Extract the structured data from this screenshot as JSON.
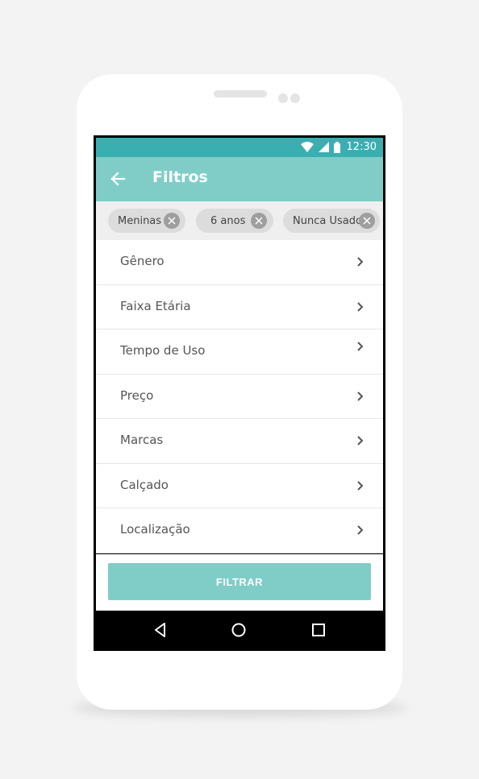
{
  "status_bar": {
    "time": "12:30",
    "icons": [
      "wifi-icon",
      "signal-icon",
      "battery-icon"
    ]
  },
  "app_bar": {
    "title": "Filtros",
    "back_icon": "arrow-left-icon"
  },
  "chips": [
    {
      "label": "Meninas",
      "remove_icon": "close-circle-icon"
    },
    {
      "label": "6 anos",
      "remove_icon": "close-circle-icon"
    },
    {
      "label": "Nunca Usado",
      "remove_icon": "close-circle-icon"
    }
  ],
  "filters": [
    {
      "label": "Gênero"
    },
    {
      "label": "Faixa Etária"
    },
    {
      "label": "Tempo de Uso"
    },
    {
      "label": "Preço"
    },
    {
      "label": "Marcas"
    },
    {
      "label": "Calçado"
    },
    {
      "label": "Localização"
    }
  ],
  "filter_button": {
    "label": "FILTRAR"
  },
  "nav_bar": {
    "icons": [
      "back-triangle-icon",
      "home-circle-icon",
      "recents-square-icon"
    ]
  },
  "colors": {
    "status_bar": "#3aafb2",
    "app_bar": "#80cdc8",
    "accent": "#80cdc8",
    "chip_bg": "#dcdcdc",
    "chip_close": "#9e9e9e"
  }
}
